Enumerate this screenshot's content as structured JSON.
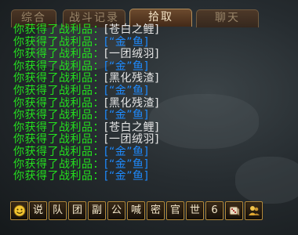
{
  "tabs": [
    {
      "label": "综合",
      "active": false
    },
    {
      "label": "战斗记录",
      "active": false
    },
    {
      "label": "拾取",
      "active": true
    },
    {
      "label": "聊天",
      "active": false
    }
  ],
  "loot": {
    "prefix": "你获得了战利品：",
    "lines": [
      {
        "item": "[苍白之鲤]",
        "quality": "grey"
      },
      {
        "item": "[“金”鱼]",
        "quality": "blue"
      },
      {
        "item": "[一团绒羽]",
        "quality": "grey"
      },
      {
        "item": "[“金”鱼]",
        "quality": "blue"
      },
      {
        "item": "[黑化残渣]",
        "quality": "grey"
      },
      {
        "item": "[“金”鱼]",
        "quality": "blue"
      },
      {
        "item": "[黑化残渣]",
        "quality": "grey"
      },
      {
        "item": "[“金”鱼]",
        "quality": "blue"
      },
      {
        "item": "[苍白之鲤]",
        "quality": "grey"
      },
      {
        "item": "[一团绒羽]",
        "quality": "grey"
      },
      {
        "item": "[“金”鱼]",
        "quality": "blue"
      },
      {
        "item": "[“金”鱼]",
        "quality": "blue"
      },
      {
        "item": "[“金”鱼]",
        "quality": "blue"
      }
    ]
  },
  "bottom_bar": {
    "buttons": [
      {
        "label": "",
        "icon": "smiley-icon"
      },
      {
        "label": "说"
      },
      {
        "label": "队"
      },
      {
        "label": "团"
      },
      {
        "label": "副"
      },
      {
        "label": "公"
      },
      {
        "label": "喊"
      },
      {
        "label": "密"
      },
      {
        "label": "官"
      },
      {
        "label": "世"
      },
      {
        "label": "6"
      },
      {
        "label": "",
        "icon": "dice-icon"
      },
      {
        "label": "",
        "icon": "social-icon"
      }
    ]
  },
  "colors": {
    "loot_prefix": "#24e01e",
    "item_common": "#e6e6e6",
    "item_rare": "#1e8bff"
  }
}
